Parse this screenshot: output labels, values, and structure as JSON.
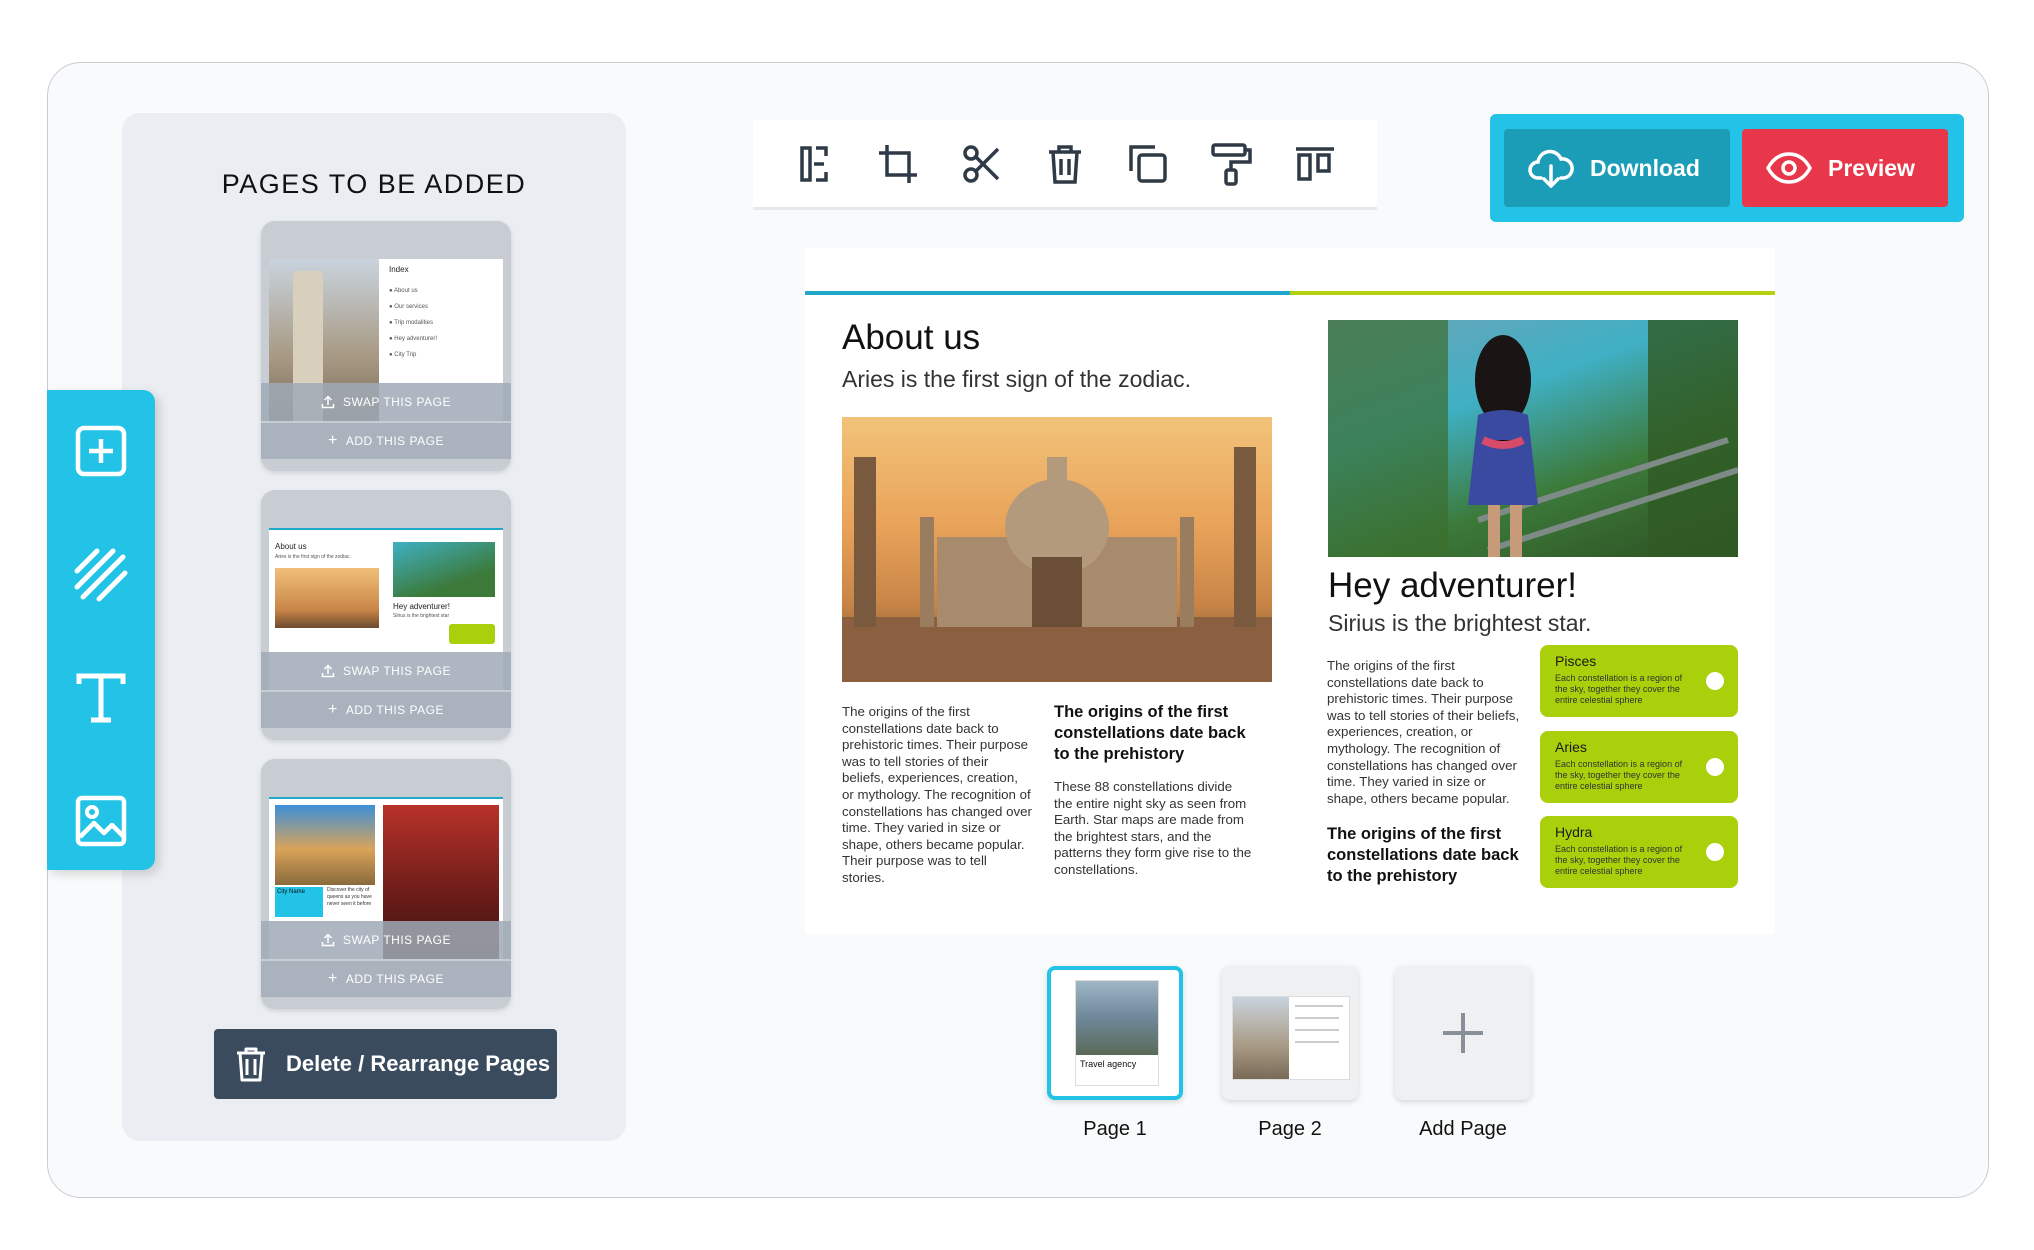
{
  "pages_panel": {
    "title": "PAGES TO BE ADDED",
    "templates": [
      {
        "swap_label": "SWAP THIS PAGE",
        "add_label": "ADD THIS PAGE",
        "preview": {
          "heading": "Index",
          "items": [
            "About us",
            "Our services",
            "Trip modalities",
            "Hey adventurer!",
            "City Trip"
          ]
        }
      },
      {
        "swap_label": "SWAP THIS PAGE",
        "add_label": "ADD THIS PAGE",
        "preview": {
          "heading": "About us",
          "sub": "Aries is the first sign of the zodiac.",
          "heading2": "Hey adventurer!",
          "sub2": "Sirius is the brightest star"
        }
      },
      {
        "swap_label": "SWAP THIS PAGE",
        "add_label": "ADD THIS PAGE",
        "preview": {
          "heading": "City Name",
          "sub": "Discover the city of queens as you have never seen it before"
        }
      }
    ],
    "delete_label": "Delete / Rearrange Pages"
  },
  "rail": {
    "items": [
      "add-element-icon",
      "pattern-icon",
      "text-icon",
      "image-icon"
    ]
  },
  "toolbar": {
    "items": [
      "resize-icon",
      "crop-icon",
      "cut-icon",
      "trash-icon",
      "duplicate-icon",
      "paint-roller-icon",
      "align-top-icon"
    ]
  },
  "actions": {
    "download_label": "Download",
    "preview_label": "Preview"
  },
  "canvas": {
    "about_title": "About us",
    "about_sub": "Aries is the first sign of the zodiac.",
    "col1_text": "The origins of the first constellations date back to prehistoric times. Their purpose was to tell stories of their beliefs, experiences, creation, or mythology. The recognition of constellations has changed over time. They varied in size or shape, others became popular.  Their purpose was to tell stories.",
    "col2_heading": "The origins of the first constellations date back to the prehistory",
    "col2_text": "These 88 constellations divide the entire night sky as seen from Earth. Star maps are made from the brightest stars, and the patterns they form give rise to the constellations.",
    "adv_title": "Hey adventurer!",
    "adv_sub": "Sirius is the brightest star.",
    "col3_text": "The origins of the first constellations date back to prehistoric times. Their purpose was to tell stories of their beliefs, experiences, creation, or mythology. The recognition of constellations has changed over time. They varied in size or shape, others became popular.",
    "col3_heading": "The origins of the first constellations date back to the prehistory",
    "cards": [
      {
        "title": "Pisces",
        "desc": "Each constellation is a region of the sky, together they cover the entire celestial sphere"
      },
      {
        "title": "Aries",
        "desc": "Each constellation is a region of the sky, together they cover the entire celestial sphere"
      },
      {
        "title": "Hydra",
        "desc": "Each constellation is a region of the sky, together they cover the entire celestial sphere"
      }
    ]
  },
  "page_strip": {
    "pages": [
      {
        "label": "Page 1",
        "caption": "Travel agency",
        "active": true
      },
      {
        "label": "Page 2",
        "active": false
      }
    ],
    "add_label": "Add Page"
  },
  "colors": {
    "accent": "#22c3e6",
    "preview": "#e8374b",
    "lime": "#a9d00a",
    "dark": "#3a4b5e"
  }
}
